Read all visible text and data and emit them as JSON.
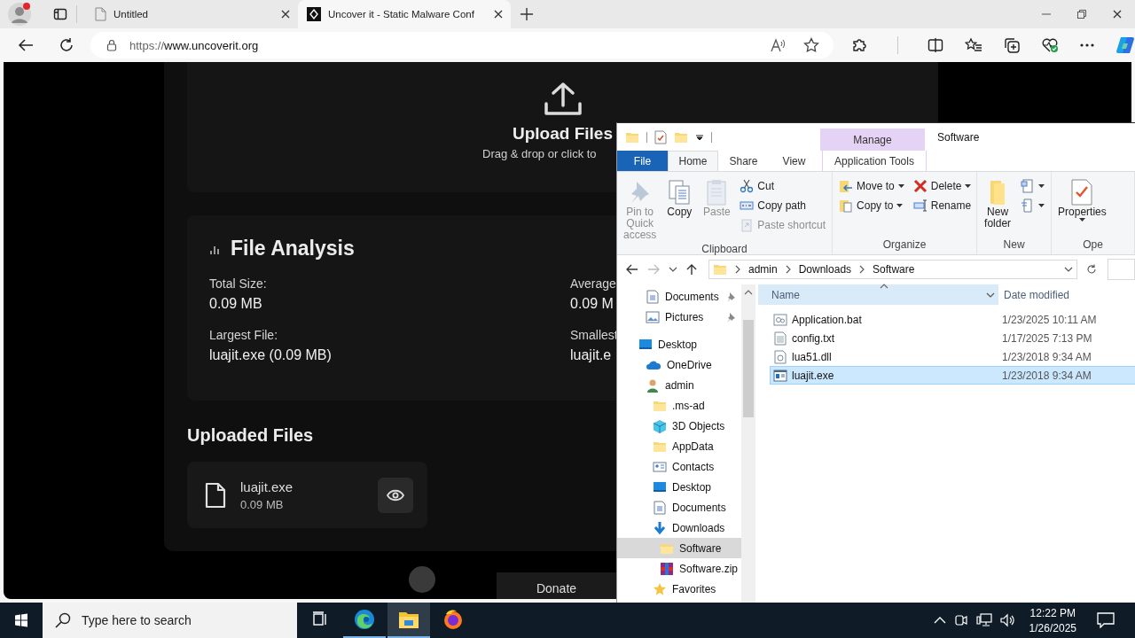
{
  "browser": {
    "tabs": [
      {
        "title": "Untitled",
        "kind": "blank",
        "selected": false
      },
      {
        "title": "Uncover it - Static Malware Conf",
        "kind": "site",
        "selected": true
      }
    ],
    "address": {
      "scheme": "https://",
      "host": "www.uncoverit.org"
    }
  },
  "page": {
    "upload": {
      "title": "Upload Files",
      "subtitle": "Drag & drop or click to"
    },
    "analysis": {
      "title": "File Analysis",
      "stats": [
        {
          "label": "Total Size:",
          "value": "0.09 MB"
        },
        {
          "label": "Average",
          "value": "0.09 M"
        },
        {
          "label": "Largest File:",
          "value": "luajit.exe (0.09 MB)"
        },
        {
          "label": "Smallest",
          "value": "luajit.e"
        }
      ]
    },
    "uploaded": {
      "title": "Uploaded Files",
      "files": [
        {
          "name": "luajit.exe",
          "size": "0.09 MB"
        }
      ]
    },
    "donate": "Donate"
  },
  "explorer": {
    "title": "Software",
    "context_tab": {
      "header": "Manage",
      "label": "Application Tools"
    },
    "tabs": [
      {
        "label": "File",
        "kind": "file",
        "selected": false
      },
      {
        "label": "Home",
        "kind": "plain",
        "selected": true
      },
      {
        "label": "Share",
        "kind": "plain",
        "selected": false
      },
      {
        "label": "View",
        "kind": "plain",
        "selected": false
      }
    ],
    "ribbon": [
      {
        "label": "Clipboard",
        "columns": [
          [
            {
              "label": "Pin to Quick access",
              "kind": "pin",
              "disabled": true,
              "dropdown": false
            }
          ],
          [
            {
              "label": "Copy",
              "kind": "copy",
              "disabled": false,
              "dropdown": false
            }
          ],
          [
            {
              "label": "Paste",
              "kind": "paste",
              "disabled": true,
              "dropdown": false
            }
          ],
          [
            {
              "label": "Cut",
              "kind": "cut",
              "disabled": false,
              "dropdown": false
            },
            {
              "label": "Copy path",
              "kind": "copy-path",
              "disabled": false,
              "dropdown": false
            },
            {
              "label": "Paste shortcut",
              "kind": "paste-shortcut",
              "disabled": true,
              "dropdown": false
            }
          ]
        ]
      },
      {
        "label": "Organize",
        "columns": [
          [
            {
              "label": "Move to",
              "kind": "move-to",
              "disabled": false,
              "dropdown": true
            },
            {
              "label": "Copy to",
              "kind": "copy-to",
              "disabled": false,
              "dropdown": true
            }
          ],
          [
            {
              "label": "Delete",
              "kind": "delete",
              "disabled": false,
              "dropdown": true
            },
            {
              "label": "Rename",
              "kind": "rename",
              "disabled": false,
              "dropdown": false
            }
          ]
        ]
      },
      {
        "label": "New",
        "columns": [
          [
            {
              "label": "New folder",
              "kind": "new-folder",
              "disabled": false,
              "dropdown": false
            }
          ],
          [
            {
              "kind": "new-item",
              "disabled": false,
              "dropdown": true
            },
            {
              "kind": "easy-access",
              "disabled": false,
              "dropdown": true
            }
          ]
        ]
      },
      {
        "label": "Ope",
        "columns": [
          [
            {
              "label": "Properties",
              "kind": "properties",
              "disabled": false,
              "dropdown": true
            }
          ]
        ]
      }
    ],
    "path": [
      "admin",
      "Downloads",
      "Software"
    ],
    "nav": {
      "quick_access": [
        {
          "label": "Documents",
          "kind": "documents",
          "pinned": true,
          "selected": false
        },
        {
          "label": "Pictures",
          "kind": "pictures",
          "pinned": true,
          "selected": false
        }
      ],
      "tree": [
        {
          "label": "Desktop",
          "kind": "desktop",
          "selected": false,
          "children": [
            {
              "label": "OneDrive",
              "kind": "onedrive",
              "selected": false
            },
            {
              "label": "admin",
              "kind": "user",
              "selected": false,
              "children": [
                {
                  "label": ".ms-ad",
                  "kind": "folder",
                  "selected": false
                },
                {
                  "label": "3D Objects",
                  "kind": "objects",
                  "selected": false
                },
                {
                  "label": "AppData",
                  "kind": "folder",
                  "selected": false
                },
                {
                  "label": "Contacts",
                  "kind": "contacts",
                  "selected": false
                },
                {
                  "label": "Desktop",
                  "kind": "desktop",
                  "selected": false
                },
                {
                  "label": "Documents",
                  "kind": "documents",
                  "selected": false
                },
                {
                  "label": "Downloads",
                  "kind": "downloads",
                  "selected": false,
                  "children": [
                    {
                      "label": "Software",
                      "kind": "folder",
                      "selected": true
                    },
                    {
                      "label": "Software.zip",
                      "kind": "zip",
                      "selected": false
                    }
                  ]
                },
                {
                  "label": "Favorites",
                  "kind": "favorites",
                  "selected": false
                }
              ]
            }
          ]
        }
      ]
    },
    "columns": [
      {
        "label": "Name",
        "sorted": true
      },
      {
        "label": "Date modified",
        "sorted": false
      }
    ],
    "files": [
      {
        "name": "Application.bat",
        "date": "1/23/2025 10:11 AM",
        "kind": "bat",
        "selected": false
      },
      {
        "name": "config.txt",
        "date": "1/17/2025 7:13 PM",
        "kind": "txt",
        "selected": false
      },
      {
        "name": "lua51.dll",
        "date": "1/23/2018 9:34 AM",
        "kind": "dll",
        "selected": false
      },
      {
        "name": "luajit.exe",
        "date": "1/23/2018 9:34 AM",
        "kind": "exe",
        "selected": true
      }
    ]
  },
  "taskbar": {
    "search_placeholder": "Type here to search",
    "apps": [
      {
        "kind": "task-view",
        "running": false,
        "active": false
      },
      {
        "kind": "edge",
        "running": true,
        "active": false
      },
      {
        "kind": "explorer",
        "running": true,
        "active": true
      },
      {
        "kind": "firefox",
        "running": false,
        "active": false
      }
    ],
    "clock": {
      "time": "12:22 PM",
      "date": "1/26/2025"
    }
  }
}
